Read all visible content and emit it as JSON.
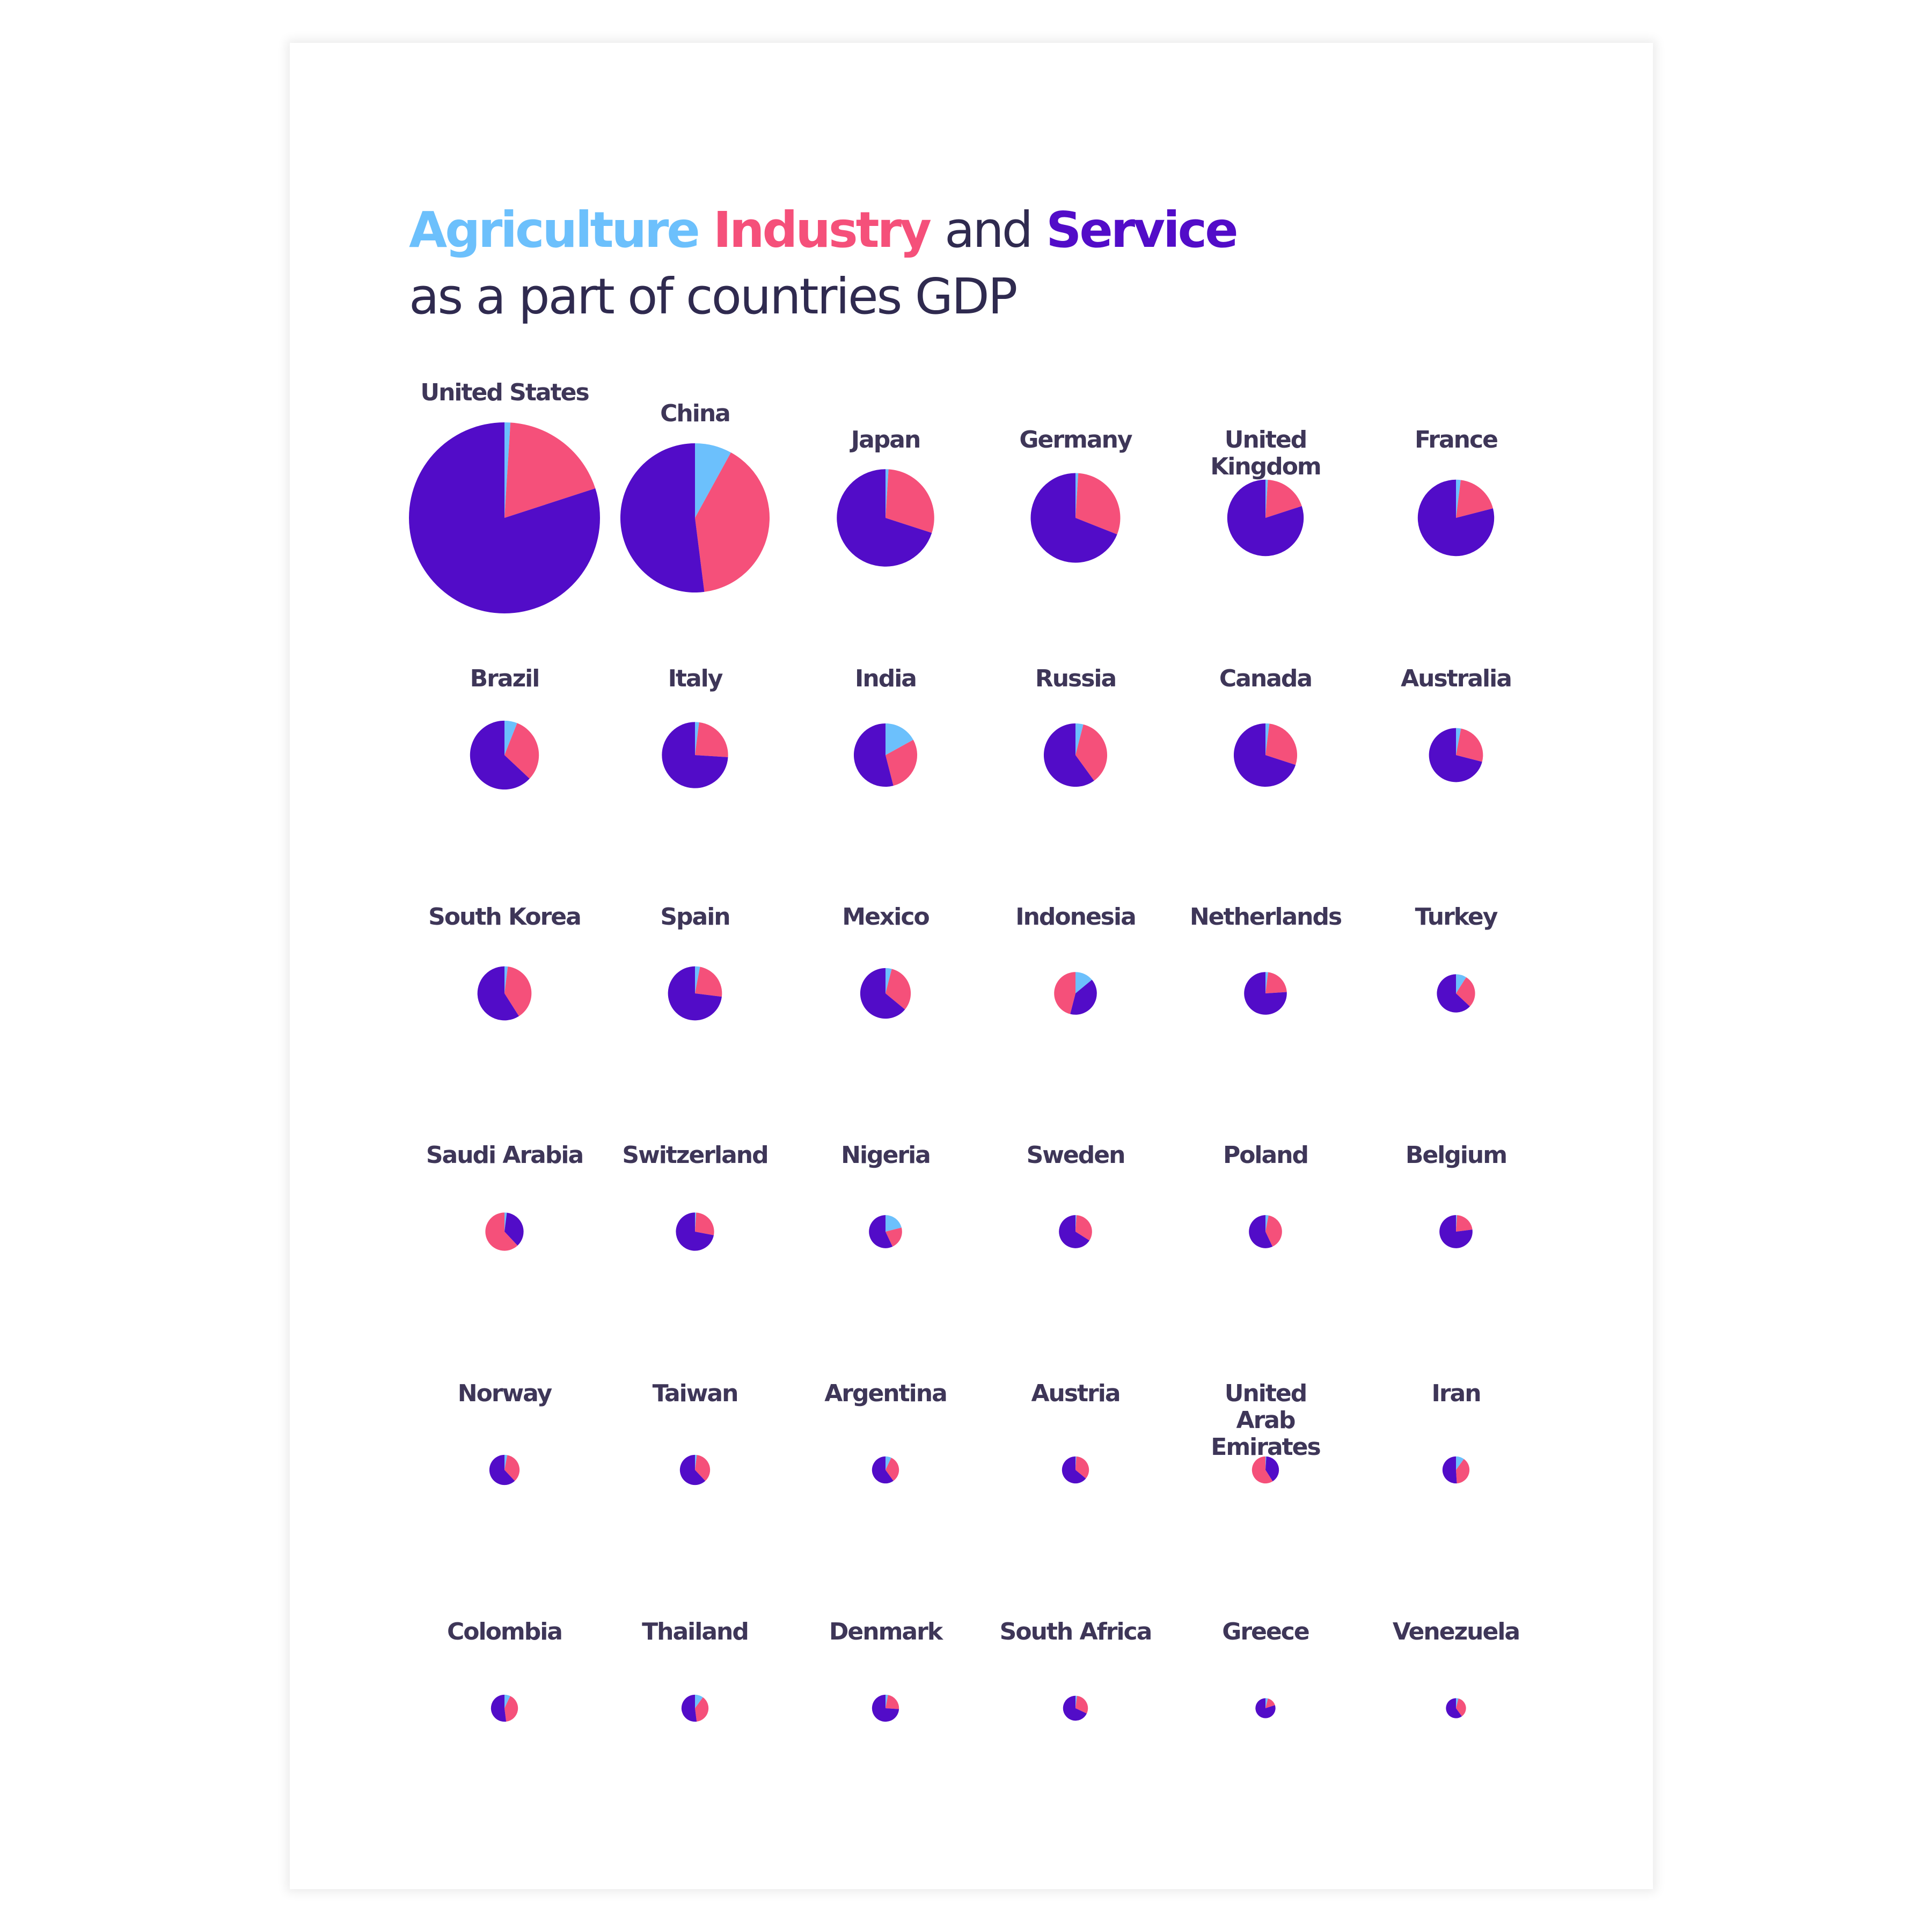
{
  "title": {
    "agriculture": "Agriculture",
    "industry": "Industry",
    "and": "and",
    "service": "Service",
    "subtitle": "as a part of countries GDP"
  },
  "colors": {
    "agriculture": "#6cc0fc",
    "industry": "#f5507a",
    "service": "#520cc8",
    "text": "#2f2a4f",
    "label": "#3e3658"
  },
  "chart_data": {
    "type": "pie",
    "title": "Agriculture Industry and Service as a part of countries GDP",
    "series_names": [
      "Agriculture",
      "Industry",
      "Service"
    ],
    "slice_order": "ascending by value, clockwise from 12 o'clock",
    "size_encoding": "pie area proportional to relative GDP (United States = 1)",
    "layout": "6 columns x 6 rows",
    "countries": [
      {
        "name": "United States",
        "relative_gdp": 1.0,
        "agriculture": 1,
        "industry": 19,
        "service": 80
      },
      {
        "name": "China",
        "relative_gdp": 0.61,
        "agriculture": 8,
        "industry": 40,
        "service": 52
      },
      {
        "name": "Japan",
        "relative_gdp": 0.26,
        "agriculture": 1,
        "industry": 29,
        "service": 70
      },
      {
        "name": "Germany",
        "relative_gdp": 0.22,
        "agriculture": 1,
        "industry": 30,
        "service": 69
      },
      {
        "name": "United Kingdom",
        "relative_gdp": 0.16,
        "agriculture": 1,
        "industry": 19,
        "service": 80
      },
      {
        "name": "France",
        "relative_gdp": 0.16,
        "agriculture": 2,
        "industry": 19,
        "service": 79
      },
      {
        "name": "Brazil",
        "relative_gdp": 0.13,
        "agriculture": 6,
        "industry": 31,
        "service": 63
      },
      {
        "name": "Italy",
        "relative_gdp": 0.12,
        "agriculture": 2,
        "industry": 24,
        "service": 74
      },
      {
        "name": "India",
        "relative_gdp": 0.11,
        "agriculture": 17,
        "industry": 29,
        "service": 54
      },
      {
        "name": "Russia",
        "relative_gdp": 0.11,
        "agriculture": 4,
        "industry": 36,
        "service": 60
      },
      {
        "name": "Canada",
        "relative_gdp": 0.11,
        "agriculture": 2,
        "industry": 28,
        "service": 70
      },
      {
        "name": "Australia",
        "relative_gdp": 0.08,
        "agriculture": 3,
        "industry": 26,
        "service": 71
      },
      {
        "name": "South Korea",
        "relative_gdp": 0.08,
        "agriculture": 2,
        "industry": 39,
        "service": 59
      },
      {
        "name": "Spain",
        "relative_gdp": 0.08,
        "agriculture": 3,
        "industry": 24,
        "service": 73
      },
      {
        "name": "Mexico",
        "relative_gdp": 0.07,
        "agriculture": 4,
        "industry": 32,
        "service": 64
      },
      {
        "name": "Indonesia",
        "relative_gdp": 0.05,
        "agriculture": 14,
        "industry": 46,
        "service": 40
      },
      {
        "name": "Netherlands",
        "relative_gdp": 0.05,
        "agriculture": 2,
        "industry": 22,
        "service": 76
      },
      {
        "name": "Turkey",
        "relative_gdp": 0.04,
        "agriculture": 9,
        "industry": 28,
        "service": 63
      },
      {
        "name": "Saudi Arabia",
        "relative_gdp": 0.04,
        "agriculture": 2,
        "industry": 62,
        "service": 36
      },
      {
        "name": "Switzerland",
        "relative_gdp": 0.04,
        "agriculture": 1,
        "industry": 27,
        "service": 72
      },
      {
        "name": "Nigeria",
        "relative_gdp": 0.03,
        "agriculture": 21,
        "industry": 22,
        "service": 57
      },
      {
        "name": "Sweden",
        "relative_gdp": 0.03,
        "agriculture": 1,
        "industry": 33,
        "service": 66
      },
      {
        "name": "Poland",
        "relative_gdp": 0.03,
        "agriculture": 3,
        "industry": 40,
        "service": 57
      },
      {
        "name": "Belgium",
        "relative_gdp": 0.03,
        "agriculture": 1,
        "industry": 22,
        "service": 77
      },
      {
        "name": "Norway",
        "relative_gdp": 0.025,
        "agriculture": 3,
        "industry": 35,
        "service": 62
      },
      {
        "name": "Taiwan",
        "relative_gdp": 0.025,
        "agriculture": 2,
        "industry": 36,
        "service": 62
      },
      {
        "name": "Argentina",
        "relative_gdp": 0.02,
        "agriculture": 7,
        "industry": 33,
        "service": 60
      },
      {
        "name": "Austria",
        "relative_gdp": 0.02,
        "agriculture": 1,
        "industry": 35,
        "service": 64
      },
      {
        "name": "United Arab Emirates",
        "relative_gdp": 0.02,
        "agriculture": 1,
        "industry": 59,
        "service": 40
      },
      {
        "name": "Iran",
        "relative_gdp": 0.02,
        "agriculture": 10,
        "industry": 39,
        "service": 51
      },
      {
        "name": "Colombia",
        "relative_gdp": 0.02,
        "agriculture": 7,
        "industry": 41,
        "service": 52
      },
      {
        "name": "Thailand",
        "relative_gdp": 0.02,
        "agriculture": 10,
        "industry": 38,
        "service": 52
      },
      {
        "name": "Denmark",
        "relative_gdp": 0.02,
        "agriculture": 3,
        "industry": 23,
        "service": 74
      },
      {
        "name": "South Africa",
        "relative_gdp": 0.017,
        "agriculture": 2,
        "industry": 30,
        "service": 68
      },
      {
        "name": "Greece",
        "relative_gdp": 0.011,
        "agriculture": 4,
        "industry": 16,
        "service": 80
      },
      {
        "name": "Venezuela",
        "relative_gdp": 0.011,
        "agriculture": 4,
        "industry": 36,
        "service": 60
      }
    ]
  }
}
